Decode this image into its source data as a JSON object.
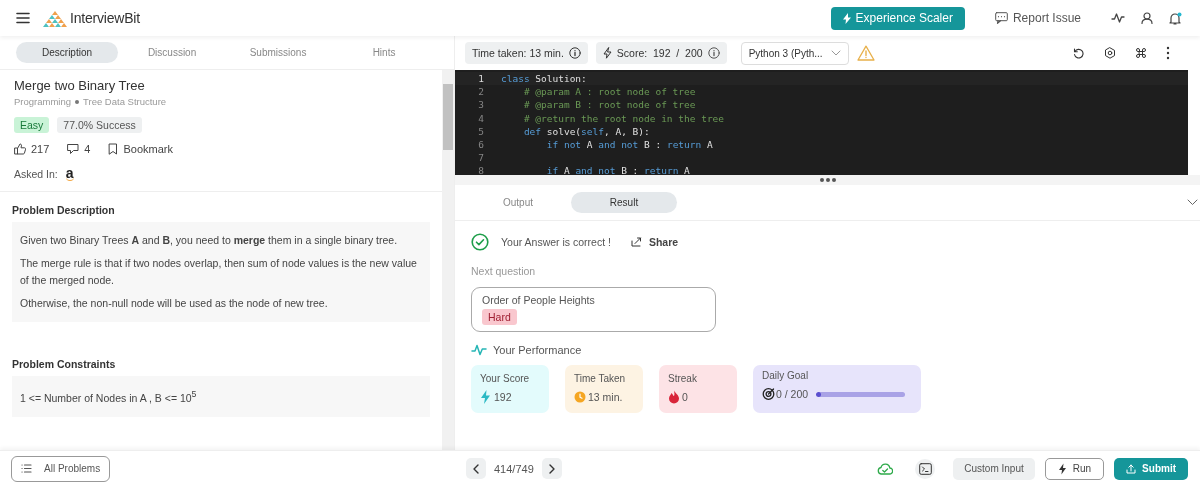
{
  "header": {
    "logo": "InterviewBit",
    "cta": "Experience Scaler",
    "report": "Report Issue"
  },
  "tabs": [
    {
      "label": "Description",
      "selected": true
    },
    {
      "label": "Discussion",
      "selected": false
    },
    {
      "label": "Submissions",
      "selected": false
    },
    {
      "label": "Hints",
      "selected": false
    }
  ],
  "toolbar": {
    "time": "Time taken: 13 min.",
    "score": "Score:  192  /  200",
    "language": "Python 3 (Pyth..."
  },
  "problem": {
    "title": "Merge two Binary Tree",
    "categories": [
      "Programming",
      "Tree Data Structure"
    ],
    "difficulty": {
      "text": "Easy",
      "kind": "easy"
    },
    "success": "77.0% Success",
    "likes": "217",
    "comments": "4",
    "bookmark": "Bookmark",
    "asked_in": "Asked In:",
    "company_logo": "a"
  },
  "sections": [
    {
      "heading": "Problem Description",
      "paragraphs": [
        "Given two Binary Trees **A** and **B**, you need to **merge** them in a single binary tree.",
        "The merge rule is that if two nodes overlap, then sum of node values is the new value of the merged node.",
        "Otherwise, the non-null node will be used as the node of new tree."
      ]
    },
    {
      "heading": "Problem Constraints",
      "paragraphs": [
        "1 <= Number of Nodes in A , B <= 10$^{5}$"
      ]
    }
  ],
  "editor": {
    "lines": [
      {
        "number": "1",
        "current": true,
        "tokens": [
          {
            "t": "class",
            "kind": "keyword"
          },
          {
            "t": " Solution:",
            "kind": "plain"
          }
        ]
      },
      {
        "number": "2",
        "current": false,
        "tokens": [
          {
            "t": "    # @param A : root node of tree",
            "kind": "comment"
          }
        ]
      },
      {
        "number": "3",
        "current": false,
        "tokens": [
          {
            "t": "    # @param B : root node of tree",
            "kind": "comment"
          }
        ]
      },
      {
        "number": "4",
        "current": false,
        "tokens": [
          {
            "t": "    # @return the root node in the tree",
            "kind": "comment"
          }
        ]
      },
      {
        "number": "5",
        "current": false,
        "tokens": [
          {
            "t": "    def",
            "kind": "keyword"
          },
          {
            "t": " solve(",
            "kind": "plain"
          },
          {
            "t": "self",
            "kind": "keyword"
          },
          {
            "t": ", A, B):",
            "kind": "plain"
          }
        ]
      },
      {
        "number": "6",
        "current": false,
        "tokens": [
          {
            "t": "        if not",
            "kind": "keyword"
          },
          {
            "t": " A ",
            "kind": "plain"
          },
          {
            "t": "and not",
            "kind": "keyword"
          },
          {
            "t": " B : ",
            "kind": "plain"
          },
          {
            "t": "return",
            "kind": "keyword"
          },
          {
            "t": " A",
            "kind": "plain"
          }
        ]
      },
      {
        "number": "7",
        "current": false
      },
      {
        "number": "8",
        "current": false,
        "tokens": [
          {
            "t": "        if",
            "kind": "keyword"
          },
          {
            "t": " A ",
            "kind": "plain"
          },
          {
            "t": "and not",
            "kind": "keyword"
          },
          {
            "t": " B : ",
            "kind": "plain"
          },
          {
            "t": "return",
            "kind": "keyword"
          },
          {
            "t": " A",
            "kind": "plain"
          }
        ]
      }
    ]
  },
  "result": {
    "tabs": [
      {
        "label": "Output",
        "selected": false
      },
      {
        "label": "Result",
        "selected": true
      }
    ],
    "message": "Your Answer is correct !",
    "share": "Share",
    "next_label": "Next question",
    "next": {
      "title": "Order of People Heights",
      "difficulty": {
        "text": "Hard",
        "kind": "hard"
      }
    },
    "performance_title": "Your Performance",
    "stats": [
      {
        "kind": "score",
        "label": "Your Score",
        "value": "192"
      },
      {
        "kind": "time",
        "label": "Time Taken",
        "value": "13 min."
      },
      {
        "kind": "streak",
        "label": "Streak",
        "value": "0"
      },
      {
        "kind": "goal",
        "label": "Daily Goal",
        "value": "0 / 200",
        "level": 0
      }
    ]
  },
  "footer": {
    "all_problems": "All Problems",
    "pager": "414/749",
    "custom_input": "Custom Input",
    "run": "Run",
    "submit": "Submit"
  }
}
